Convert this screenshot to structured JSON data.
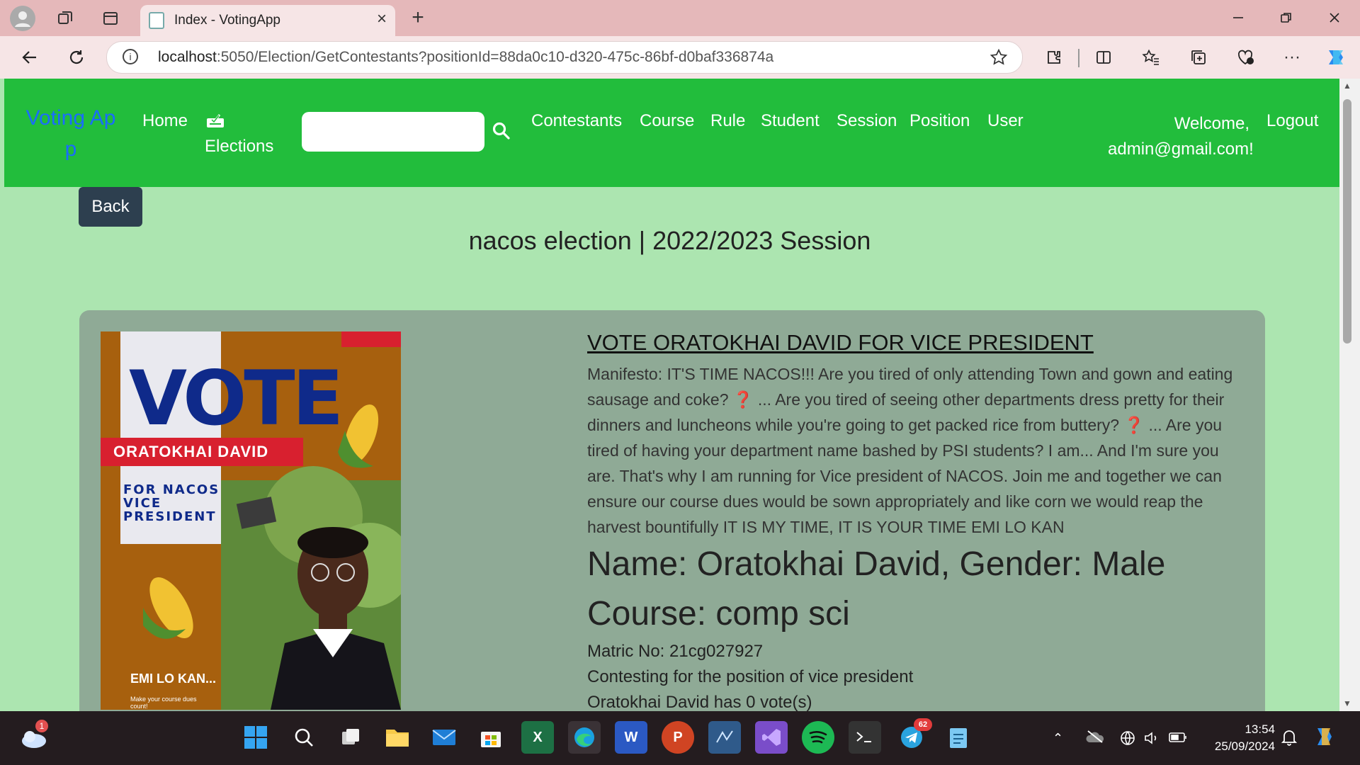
{
  "browser": {
    "tab_title": "Index - VotingApp",
    "url_host": "localhost",
    "url_rest": ":5050/Election/GetContestants?positionId=88da0c10-d320-475c-86bf-d0baf336874a"
  },
  "nav": {
    "brand_line1": "Voting Ap",
    "brand_line2": "p",
    "home": "Home",
    "elections": "Elections",
    "search_placeholder": "",
    "links": [
      "Contestants",
      "Course",
      "Rule",
      "Student",
      "Session",
      "Position",
      "User"
    ],
    "welcome_line1": "Welcome,",
    "welcome_line2": "admin@gmail.com!",
    "logout": "Logout"
  },
  "content": {
    "back": "Back",
    "election_title": "nacos election | 2022/2023 Session"
  },
  "contestant": {
    "headline": "VOTE ORATOKHAI DAVID FOR VICE PRESIDENT",
    "manifesto": "Manifesto: IT'S TIME NACOS!!! Are you tired of only attending Town and gown and eating sausage and coke? ❓ ... Are you tired of seeing other departments dress pretty for their dinners and luncheons while you're going to get packed rice from buttery? ❓ ... Are you tired of having your department name bashed by PSI students? I am... And I'm sure you are. That's why I am running for Vice president of NACOS. Join me and together we can ensure our course dues would be sown appropriately and like corn we would reap the harvest bountifully IT IS MY TIME, IT IS YOUR TIME EMI LO KAN",
    "name_gender": "Name: Oratokhai David, Gender: Male",
    "course": "Course: comp sci",
    "matric": "Matric No: 21cg027927",
    "position": "Contesting for the position of vice president",
    "votes": "Oratokhai David has 0 vote(s)"
  },
  "poster": {
    "vote": "VOTE",
    "name": "ORATOKHAI DAVID",
    "for_line1": "FOR NACOS",
    "for_line2": "VICE",
    "for_line3": "PRESIDENT",
    "slogan": "EMI LO KAN...",
    "small_text": "Make your course dues count!"
  },
  "taskbar": {
    "time": "13:54",
    "date": "25/09/2024",
    "weather_badge": "1",
    "telegram_badge": "62"
  },
  "colors": {
    "navbar": "#22bd3c",
    "page_bg": "#ace5b0",
    "card_bg": "#8faa96",
    "brand": "#1a6cff",
    "back_button": "#2d3f4f"
  }
}
